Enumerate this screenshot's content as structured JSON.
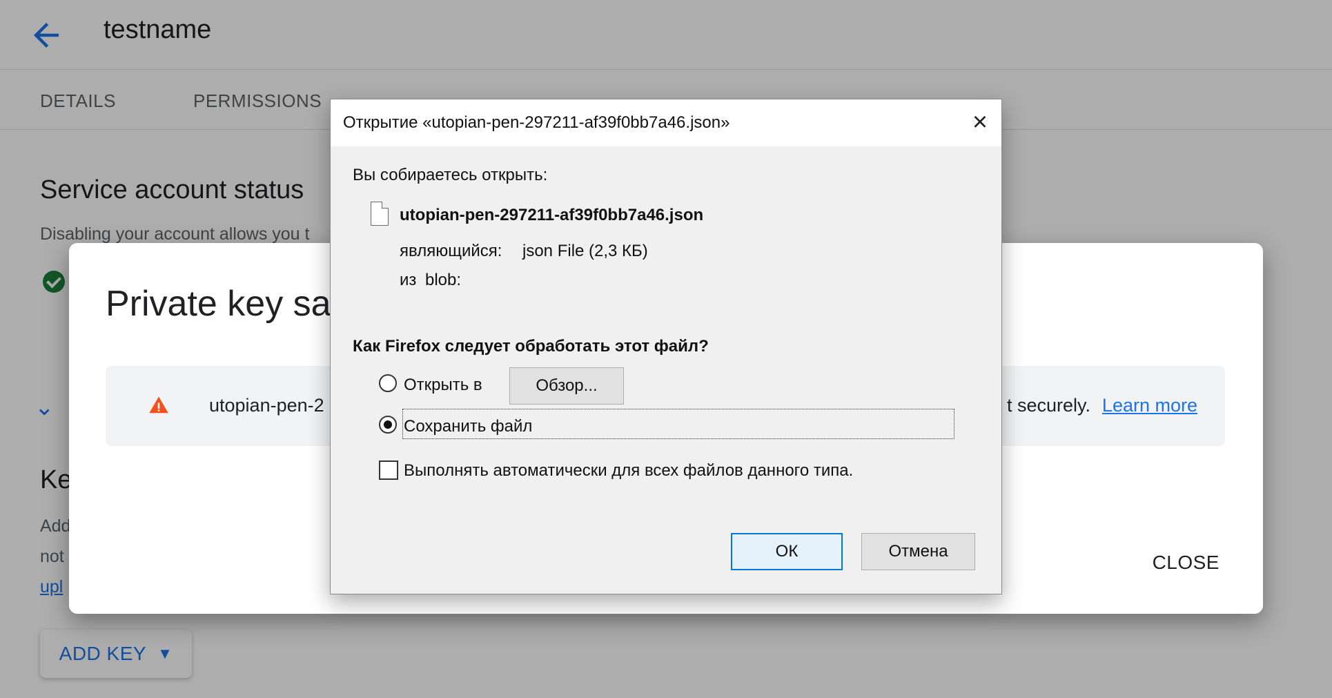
{
  "page": {
    "title": "testname",
    "tabs": [
      "DETAILS",
      "PERMISSIONS"
    ],
    "status_heading": "Service account status",
    "status_desc": "Disabling your account allows you t",
    "keys_heading": "Ke",
    "keys_desc_1": "Add",
    "keys_desc_2": "not",
    "keys_desc_3": "upl",
    "add_key_label": "ADD KEY",
    "chevron_icon": "chevron-down-icon",
    "check_icon": "check-circle-icon",
    "back_icon": "arrow-left-icon"
  },
  "modal": {
    "title": "Private key sa",
    "filename_fragment": "utopian-pen-2",
    "tail_text": "t securely.",
    "learn_more": "Learn more",
    "close_label": "CLOSE",
    "warning_icon": "warning-icon"
  },
  "dialog": {
    "title": "Открытие «utopian-pen-297211-af39f0bb7a46.json»",
    "close_icon": "close-icon",
    "open_label": "Вы собираетесь открыть:",
    "file_name": "utopian-pen-297211-af39f0bb7a46.json",
    "type_label": "являющийся:",
    "type_value": "json File (2,3 КБ)",
    "from_label": "из",
    "from_value": "blob:",
    "question": "Как Firefox следует обработать этот файл?",
    "open_with": "Открыть в",
    "browse": "Обзор...",
    "save_file": "Сохранить файл",
    "auto": "Выполнять автоматически для всех файлов данного типа.",
    "ok": "ОК",
    "cancel": "Отмена",
    "file_icon": "file-icon"
  }
}
